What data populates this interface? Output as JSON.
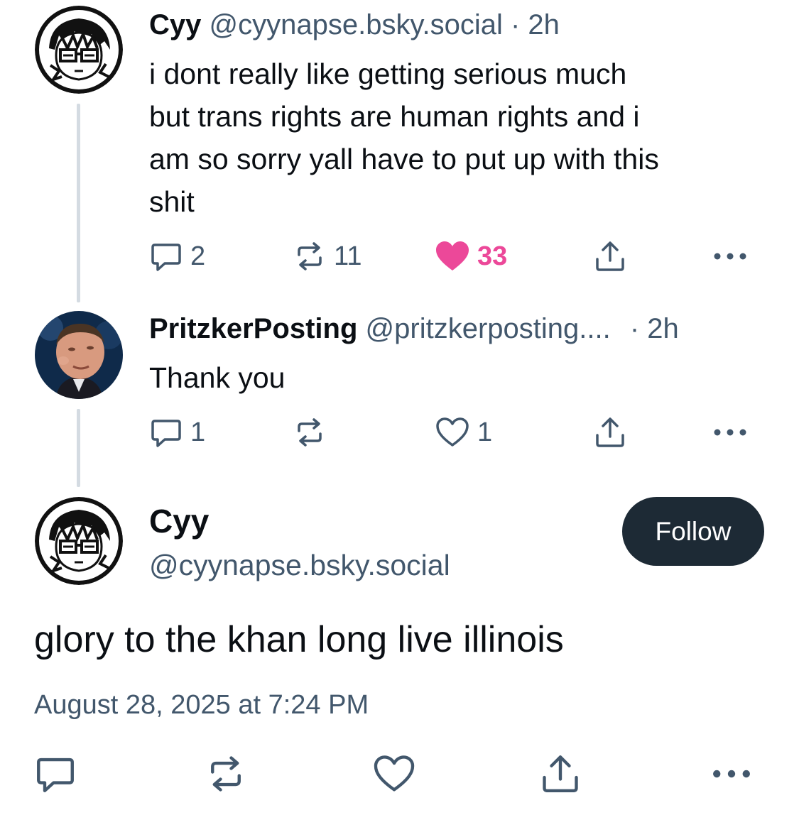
{
  "posts": [
    {
      "name": "Cyy",
      "handle": "@cyynapse.bsky.social",
      "time": "· 2h",
      "lines": [
        "i dont really like getting serious much",
        "but trans rights are human rights and i",
        "am so sorry yall have to put up with this",
        "shit"
      ],
      "replies": "2",
      "reposts": "11",
      "likes": "33",
      "liked": true
    },
    {
      "name": "PritzkerPosting",
      "handle": "@pritzkerposting....",
      "time": "· 2h",
      "lines": [
        "Thank you"
      ],
      "replies": "1",
      "reposts": "",
      "likes": "1",
      "liked": false
    }
  ],
  "focus": {
    "name": "Cyy",
    "handle": "@cyynapse.bsky.social",
    "follow_label": "Follow",
    "text": "glory to the khan long live illinois",
    "timestamp": "August 28, 2025 at 7:24 PM"
  },
  "icons": {
    "reply": "speech-bubble-icon",
    "repost": "repost-arrows-icon",
    "like": "heart-icon",
    "share": "share-upload-icon",
    "more": "ellipsis-icon"
  },
  "colors": {
    "text": "#0b0f14",
    "secondary": "#42576c",
    "like": "#ec4899",
    "follow_bg": "#1d2a35",
    "thread_line": "#d4dbe2"
  }
}
